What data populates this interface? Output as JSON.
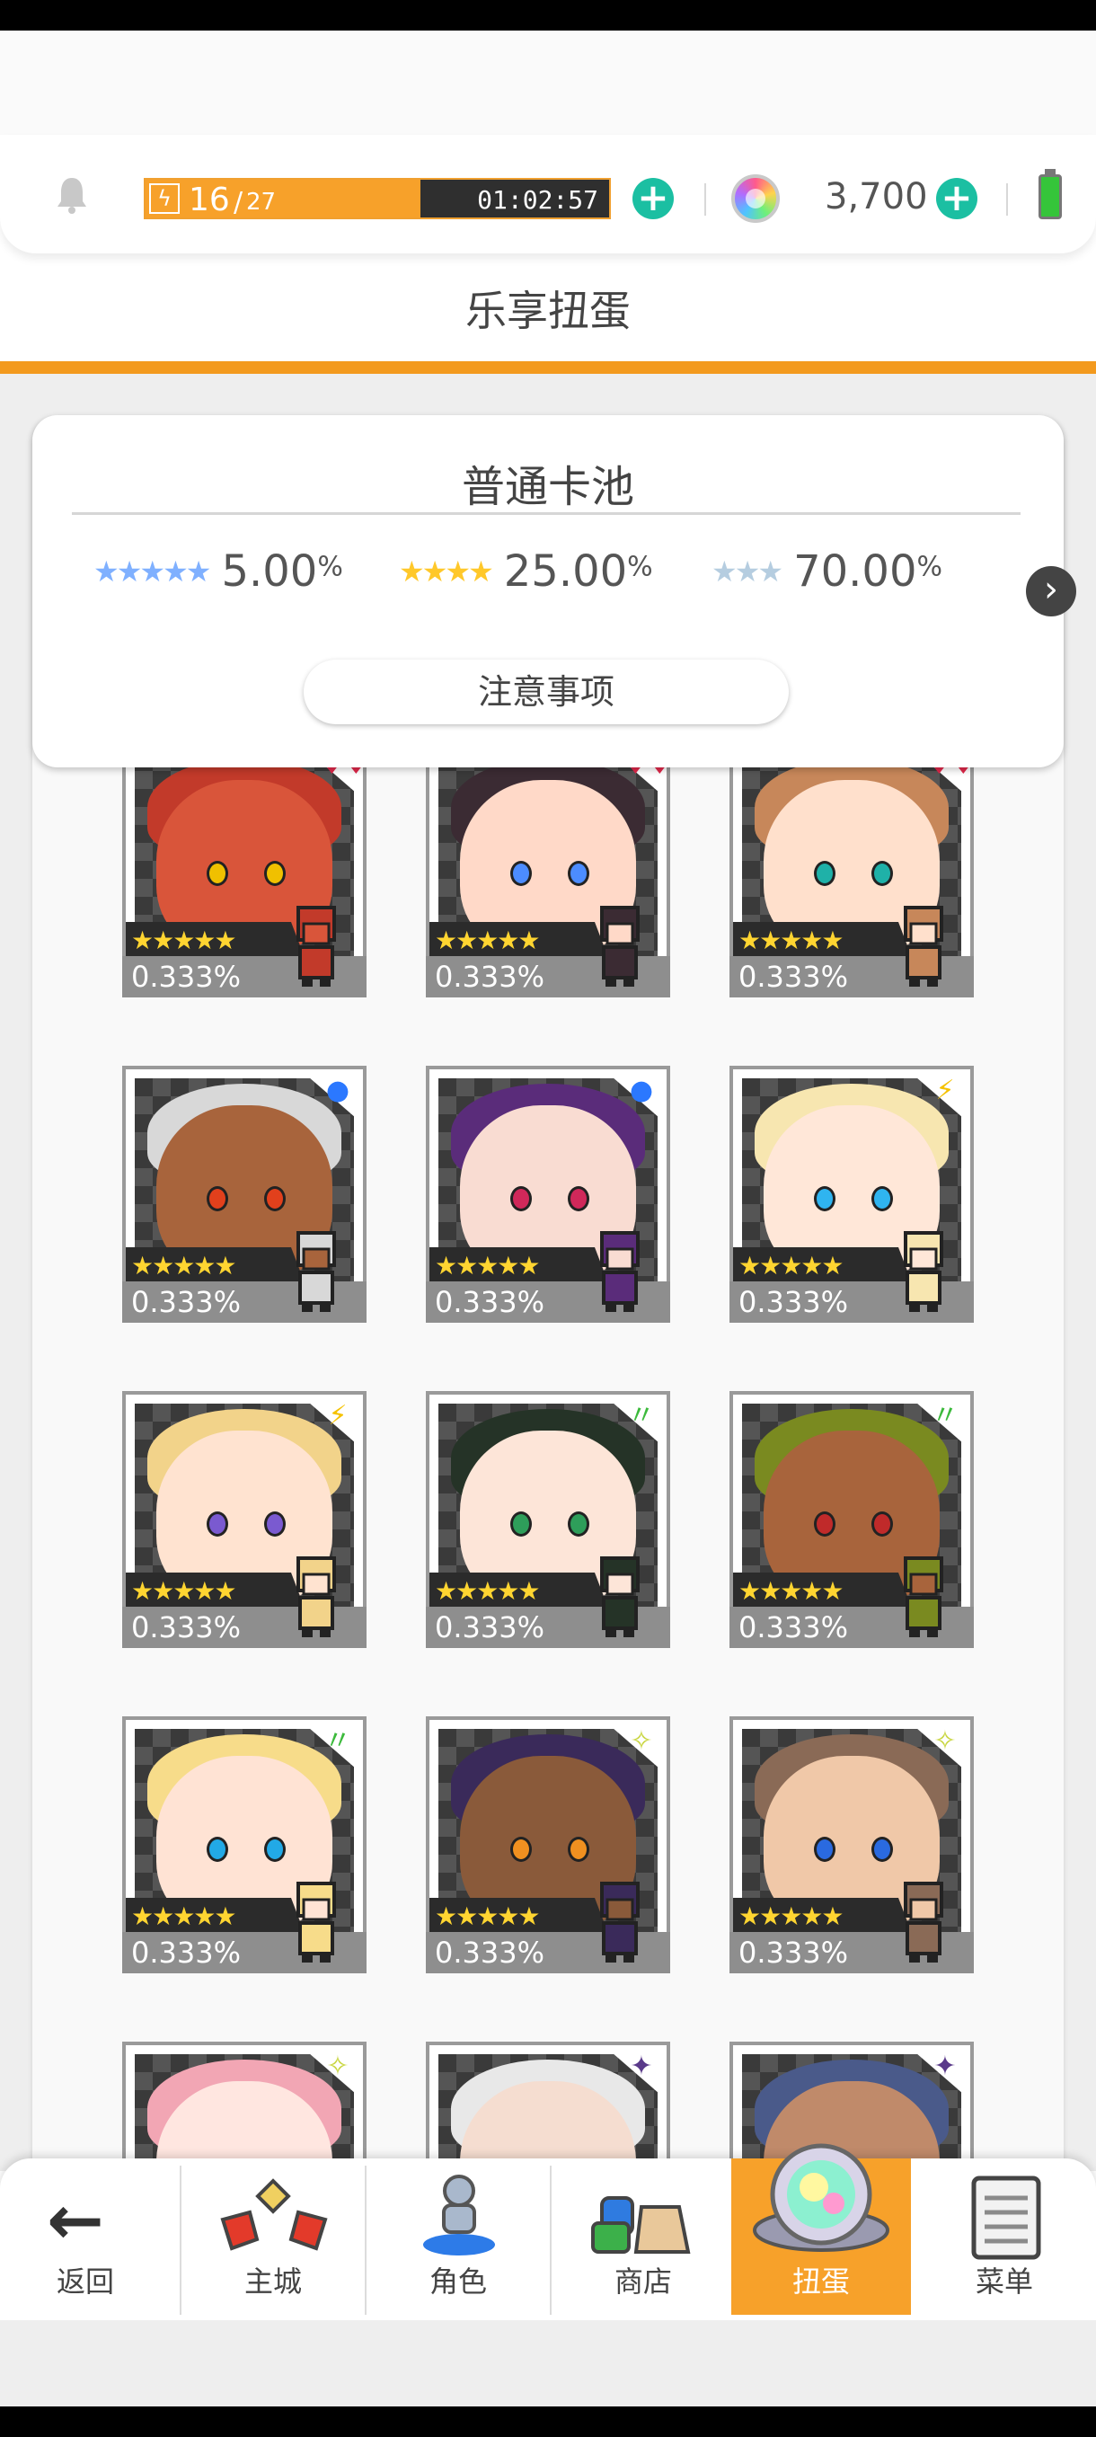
{
  "header": {
    "stamina_current": "16",
    "stamina_max": "27",
    "stamina_fill_fraction": 0.593,
    "stamina_timer": "01:02:57",
    "gem_count": "3,700",
    "icons": [
      "bell-icon",
      "lightning-icon",
      "plus-icon",
      "rainbow-orb-icon",
      "battery-icon"
    ]
  },
  "page_title": "乐享扭蛋",
  "pool": {
    "title": "普通卡池",
    "rates": [
      {
        "stars": "★★★★★",
        "value": "5.00",
        "unit": "%",
        "color": "#7fb0ff"
      },
      {
        "stars": "★★★★",
        "value": "25.00",
        "unit": "%",
        "color": "#ffc82a"
      },
      {
        "stars": "★★★",
        "value": "70.00",
        "unit": "%",
        "color": "#b5cde0"
      }
    ],
    "notice_label": "注意事项"
  },
  "characters": [
    {
      "rate": "0.333%",
      "stars": "★★★★★",
      "element": "♦♦",
      "element_color": "#e0284a",
      "hair": "#c23a2a",
      "skin": "#d9553a",
      "eye": "#f0c000"
    },
    {
      "rate": "0.333%",
      "stars": "★★★★★",
      "element": "♦♦",
      "element_color": "#e0284a",
      "hair": "#3b2b33",
      "skin": "#ffd9c8",
      "eye": "#4c8cff"
    },
    {
      "rate": "0.333%",
      "stars": "★★★★★",
      "element": "♦♦",
      "element_color": "#e0284a",
      "hair": "#c7875a",
      "skin": "#ffe0cc",
      "eye": "#1fb1a8"
    },
    {
      "rate": "0.333%",
      "stars": "★★★★★",
      "element": "●",
      "element_color": "#2b78ff",
      "hair": "#d8d8d8",
      "skin": "#a8643c",
      "eye": "#e2401c"
    },
    {
      "rate": "0.333%",
      "stars": "★★★★★",
      "element": "●",
      "element_color": "#2b78ff",
      "hair": "#5a2c7a",
      "skin": "#f9dcd2",
      "eye": "#d0285a"
    },
    {
      "rate": "0.333%",
      "stars": "★★★★★",
      "element": "⚡",
      "element_color": "#f5c200",
      "hair": "#f7e6b0",
      "skin": "#ffe7d8",
      "eye": "#2fb4f0"
    },
    {
      "rate": "0.333%",
      "stars": "★★★★★",
      "element": "⚡",
      "element_color": "#f5c200",
      "hair": "#f2d38a",
      "skin": "#ffe3d0",
      "eye": "#7a5ad0"
    },
    {
      "rate": "0.333%",
      "stars": "★★★★★",
      "element": "〃",
      "element_color": "#3cba3c",
      "hair": "#253327",
      "skin": "#fde5d8",
      "eye": "#2e9e5a"
    },
    {
      "rate": "0.333%",
      "stars": "★★★★★",
      "element": "〃",
      "element_color": "#3cba3c",
      "hair": "#7a8a20",
      "skin": "#a8643c",
      "eye": "#c02a2a"
    },
    {
      "rate": "0.333%",
      "stars": "★★★★★",
      "element": "〃",
      "element_color": "#3cba3c",
      "hair": "#f7dc8a",
      "skin": "#ffe3d4",
      "eye": "#22a9e6"
    },
    {
      "rate": "0.333%",
      "stars": "★★★★★",
      "element": "✧",
      "element_color": "#c9d640",
      "hair": "#3a2a5a",
      "skin": "#8a5a3a",
      "eye": "#f09020"
    },
    {
      "rate": "0.333%",
      "stars": "★★★★★",
      "element": "✧",
      "element_color": "#c9d640",
      "hair": "#8a6a56",
      "skin": "#f0c8a8",
      "eye": "#2a6ae0"
    },
    {
      "rate": "",
      "stars": "",
      "element": "✧",
      "element_color": "#c9d640",
      "hair": "#f2a6b4",
      "skin": "#ffe6e0",
      "eye": "#2a9ae0"
    },
    {
      "rate": "",
      "stars": "",
      "element": "✦",
      "element_color": "#5a3a8a",
      "hair": "#e8e8e8",
      "skin": "#f5ddd0",
      "eye": "#555"
    },
    {
      "rate": "",
      "stars": "",
      "element": "✦",
      "element_color": "#5a3a8a",
      "hair": "#4a5a8a",
      "skin": "#c08a6a",
      "eye": "#555"
    }
  ],
  "nav": [
    {
      "label": "返回",
      "icon": "back-arrow-icon"
    },
    {
      "label": "主城",
      "icon": "castle-icon"
    },
    {
      "label": "角色",
      "icon": "character-icon"
    },
    {
      "label": "商店",
      "icon": "shop-icon"
    },
    {
      "label": "扭蛋",
      "icon": "gacha-icon",
      "active": true
    },
    {
      "label": "菜单",
      "icon": "menu-icon"
    }
  ]
}
